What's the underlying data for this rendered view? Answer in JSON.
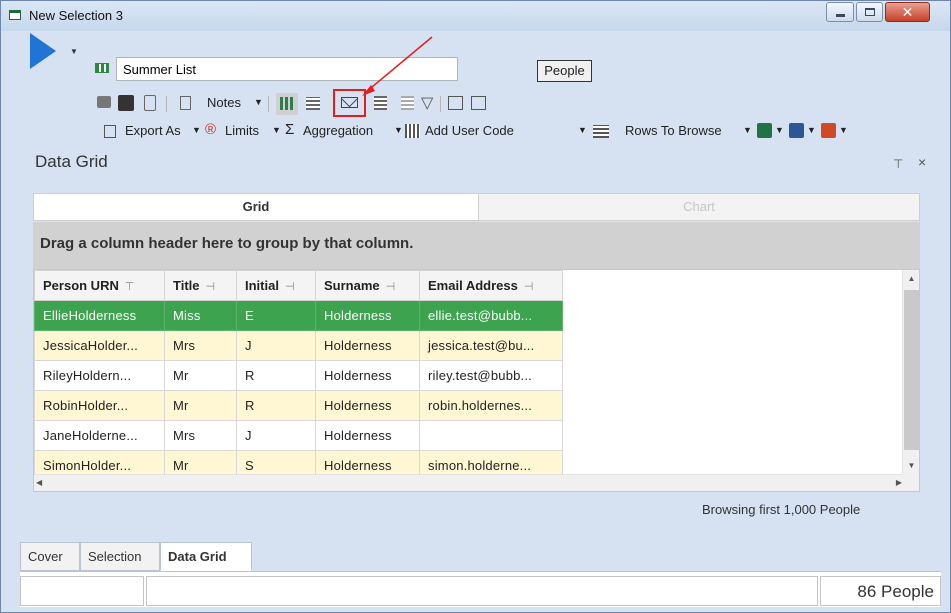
{
  "window": {
    "title": "New Selection 3"
  },
  "toolbar": {
    "selection_name": "Summer List",
    "people_button": "People",
    "notes_label": "Notes",
    "export_as": "Export As",
    "limits": "Limits",
    "aggregation": "Aggregation",
    "add_user_code": "Add User Code",
    "rows_to_browse": "Rows To Browse"
  },
  "panel": {
    "title": "Data Grid"
  },
  "tabs": {
    "grid": "Grid",
    "chart": "Chart"
  },
  "group_hint": "Drag a column header here to group by that column.",
  "grid": {
    "columns": [
      "Person URN",
      "Title",
      "Initial",
      "Surname",
      "Email Address"
    ],
    "rows": [
      {
        "urn": "EllieHolderness",
        "title": "Miss",
        "initial": "E",
        "surname": "Holderness",
        "email": "ellie.test@bubb..."
      },
      {
        "urn": "JessicaHolder...",
        "title": "Mrs",
        "initial": "J",
        "surname": "Holderness",
        "email": "jessica.test@bu..."
      },
      {
        "urn": "RileyHoldern...",
        "title": "Mr",
        "initial": "R",
        "surname": "Holderness",
        "email": "riley.test@bubb..."
      },
      {
        "urn": "RobinHolder...",
        "title": "Mr",
        "initial": "R",
        "surname": "Holderness",
        "email": "robin.holdernes..."
      },
      {
        "urn": "JaneHolderne...",
        "title": "Mrs",
        "initial": "J",
        "surname": "Holderness",
        "email": ""
      },
      {
        "urn": "SimonHolder...",
        "title": "Mr",
        "initial": "S",
        "surname": "Holderness",
        "email": "simon.holderne..."
      }
    ]
  },
  "browse_status": "Browsing first 1,000 People",
  "bottom_tabs": [
    "Cover",
    "Selection",
    "Data Grid"
  ],
  "status": {
    "count": "86 People"
  },
  "colors": {
    "selected_row": "#3da34f",
    "alt_row": "#fff6d3",
    "annotation": "#e0201d",
    "play": "#1f74d6"
  },
  "icons": [
    "play-icon",
    "grid-icon",
    "lock-icon",
    "save-icon",
    "notes-icon",
    "email-icon",
    "filter-icon",
    "export-icon",
    "limits-icon",
    "sigma-icon",
    "excel-icon",
    "word-icon",
    "powerpoint-icon"
  ]
}
